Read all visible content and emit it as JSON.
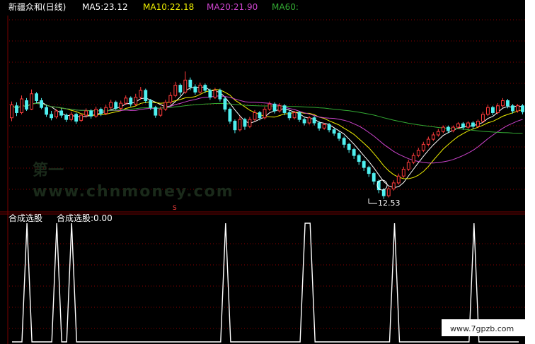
{
  "header": {
    "title": "新疆众和(日线)",
    "ma5": "MA5:23.12",
    "ma10": "MA10:22.18",
    "ma20": "MA20:21.90",
    "ma60": "MA60:"
  },
  "annotation": {
    "low_label": "12.53",
    "marker": "S"
  },
  "watermark": {
    "top": "第一",
    "bottom": "www.chnmoney.com"
  },
  "indicator": {
    "name": "合成选股",
    "value_label": "合成选股:0.00"
  },
  "site_label": "www.7gpzb.com",
  "colors": {
    "background": "#000000",
    "up_candle": "#ff3b3b",
    "down_candle": "#4ff0f0",
    "ma5": "#ffffff",
    "ma10": "#f0f000",
    "ma20": "#cc44cc",
    "ma60": "#33aa33",
    "grid": "#8a0000",
    "signal": "#ffffff"
  },
  "chart_data": [
    {
      "type": "candlestick",
      "title": "新疆众和(日线)",
      "note": "",
      "series": [
        {
          "name": "MA5",
          "last": 23.12
        },
        {
          "name": "MA10",
          "last": 22.18
        },
        {
          "name": "MA20",
          "last": 21.9
        },
        {
          "name": "MA60",
          "last": null
        }
      ],
      "ylim": [
        12,
        30
      ],
      "candles": [
        [
          22.0,
          23.5,
          21.6,
          23.9
        ],
        [
          23.4,
          22.6,
          22.2,
          23.8
        ],
        [
          22.6,
          24.2,
          22.4,
          24.6
        ],
        [
          24.0,
          23.0,
          22.8,
          24.3
        ],
        [
          23.0,
          24.8,
          22.9,
          25.3
        ],
        [
          24.8,
          24.0,
          23.7,
          25.0
        ],
        [
          24.0,
          23.2,
          23.0,
          24.3
        ],
        [
          23.2,
          22.4,
          22.1,
          23.5
        ],
        [
          22.4,
          22.0,
          21.7,
          22.8
        ],
        [
          22.1,
          22.8,
          21.9,
          23.0
        ],
        [
          22.8,
          22.3,
          22.0,
          23.1
        ],
        [
          22.3,
          21.8,
          21.5,
          22.5
        ],
        [
          21.8,
          22.4,
          21.6,
          22.7
        ],
        [
          22.4,
          21.6,
          21.3,
          22.6
        ],
        [
          21.7,
          22.3,
          21.5,
          22.5
        ],
        [
          22.3,
          22.8,
          22.0,
          23.1
        ],
        [
          22.8,
          22.2,
          21.9,
          23.0
        ],
        [
          22.2,
          23.0,
          22.0,
          23.3
        ],
        [
          23.0,
          22.5,
          22.2,
          23.2
        ],
        [
          22.5,
          23.2,
          22.3,
          23.5
        ],
        [
          23.2,
          23.8,
          23.0,
          24.1
        ],
        [
          23.8,
          23.1,
          22.9,
          24.0
        ],
        [
          23.1,
          23.7,
          22.9,
          24.0
        ],
        [
          23.7,
          24.3,
          23.5,
          24.6
        ],
        [
          24.3,
          23.6,
          23.3,
          24.5
        ],
        [
          23.6,
          24.4,
          23.4,
          24.8
        ],
        [
          24.4,
          25.2,
          24.1,
          25.6
        ],
        [
          25.2,
          24.0,
          23.7,
          25.4
        ],
        [
          24.0,
          23.2,
          22.9,
          24.2
        ],
        [
          23.2,
          22.3,
          22.0,
          23.4
        ],
        [
          22.3,
          23.0,
          22.1,
          23.3
        ],
        [
          23.0,
          23.8,
          22.8,
          24.1
        ],
        [
          23.8,
          24.6,
          23.6,
          25.0
        ],
        [
          24.6,
          25.8,
          24.4,
          26.2
        ],
        [
          25.8,
          25.0,
          24.6,
          26.0
        ],
        [
          25.0,
          26.4,
          24.8,
          27.4
        ],
        [
          26.4,
          25.6,
          25.2,
          26.7
        ],
        [
          25.6,
          25.0,
          24.7,
          25.9
        ],
        [
          25.0,
          25.8,
          24.8,
          26.1
        ],
        [
          25.8,
          25.2,
          24.9,
          26.0
        ],
        [
          25.2,
          24.4,
          24.1,
          25.4
        ],
        [
          24.4,
          25.2,
          24.2,
          25.5
        ],
        [
          25.2,
          24.2,
          23.9,
          25.4
        ],
        [
          24.2,
          23.0,
          22.7,
          24.4
        ],
        [
          23.0,
          21.6,
          21.3,
          23.2
        ],
        [
          21.6,
          20.6,
          20.2,
          21.8
        ],
        [
          20.6,
          21.8,
          20.4,
          22.2
        ],
        [
          21.8,
          21.0,
          20.6,
          22.0
        ],
        [
          21.0,
          21.8,
          20.8,
          22.1
        ],
        [
          21.8,
          22.6,
          21.6,
          22.9
        ],
        [
          22.6,
          22.0,
          21.7,
          22.8
        ],
        [
          22.0,
          23.0,
          21.8,
          23.3
        ],
        [
          23.0,
          23.6,
          22.8,
          23.9
        ],
        [
          23.6,
          22.8,
          22.5,
          23.8
        ],
        [
          22.8,
          23.4,
          22.6,
          23.7
        ],
        [
          23.4,
          22.6,
          22.3,
          23.6
        ],
        [
          22.6,
          22.0,
          21.7,
          22.8
        ],
        [
          22.0,
          22.6,
          21.8,
          22.8
        ],
        [
          22.6,
          21.8,
          21.5,
          22.8
        ],
        [
          21.8,
          21.4,
          21.1,
          22.0
        ],
        [
          21.4,
          22.0,
          21.2,
          22.2
        ],
        [
          22.0,
          21.4,
          21.1,
          22.2
        ],
        [
          21.4,
          20.8,
          20.5,
          21.6
        ],
        [
          20.8,
          21.2,
          20.6,
          21.4
        ],
        [
          21.2,
          20.6,
          20.3,
          21.4
        ],
        [
          20.6,
          20.2,
          19.9,
          20.8
        ],
        [
          20.2,
          19.6,
          19.3,
          20.4
        ],
        [
          19.6,
          18.9,
          18.5,
          19.8
        ],
        [
          18.9,
          18.3,
          17.9,
          19.1
        ],
        [
          18.3,
          17.6,
          17.2,
          18.5
        ],
        [
          17.6,
          16.9,
          16.5,
          17.8
        ],
        [
          16.9,
          16.2,
          15.8,
          17.1
        ],
        [
          16.2,
          15.5,
          15.1,
          16.4
        ],
        [
          15.5,
          14.6,
          14.2,
          15.7
        ],
        [
          14.6,
          13.6,
          13.2,
          14.8
        ],
        [
          13.6,
          12.9,
          12.53,
          13.8
        ],
        [
          12.9,
          13.7,
          12.7,
          14.0
        ],
        [
          13.7,
          14.4,
          13.5,
          14.7
        ],
        [
          14.4,
          15.2,
          14.2,
          15.5
        ],
        [
          15.2,
          16.0,
          15.0,
          16.3
        ],
        [
          16.0,
          16.8,
          15.8,
          17.1
        ],
        [
          16.8,
          17.6,
          16.6,
          17.9
        ],
        [
          17.6,
          18.2,
          17.4,
          18.5
        ],
        [
          18.2,
          18.9,
          18.0,
          19.2
        ],
        [
          18.9,
          19.5,
          18.7,
          19.8
        ],
        [
          19.5,
          20.0,
          19.3,
          20.3
        ],
        [
          20.0,
          20.4,
          19.8,
          20.7
        ],
        [
          20.4,
          20.9,
          20.2,
          21.1
        ],
        [
          20.9,
          20.5,
          20.2,
          21.1
        ],
        [
          20.5,
          20.9,
          20.3,
          21.1
        ],
        [
          20.9,
          21.3,
          20.7,
          21.5
        ],
        [
          21.3,
          20.9,
          20.6,
          21.5
        ],
        [
          20.9,
          21.4,
          20.7,
          21.6
        ],
        [
          21.4,
          21.0,
          20.7,
          21.6
        ],
        [
          21.0,
          21.6,
          20.8,
          21.8
        ],
        [
          21.6,
          22.4,
          21.4,
          22.7
        ],
        [
          22.4,
          23.2,
          22.2,
          23.5
        ],
        [
          23.2,
          22.6,
          22.3,
          23.4
        ],
        [
          22.6,
          23.4,
          22.4,
          23.7
        ],
        [
          23.4,
          24.0,
          23.2,
          24.3
        ],
        [
          24.0,
          23.4,
          23.1,
          24.2
        ],
        [
          23.4,
          22.8,
          22.5,
          23.6
        ],
        [
          22.8,
          23.4,
          22.6,
          23.6
        ],
        [
          23.4,
          22.7,
          22.4,
          23.6
        ]
      ]
    },
    {
      "type": "line",
      "title": "合成选股",
      "series": [
        {
          "name": "合成选股",
          "last": 0.0
        }
      ],
      "ylim": [
        0,
        1
      ],
      "signal_index_hint": [
        1,
        9,
        12,
        44,
        59,
        76,
        93
      ],
      "levels": [
        0,
        0,
        0,
        1,
        0,
        0,
        0,
        0,
        0,
        1,
        0,
        0,
        1,
        0,
        0,
        0,
        0,
        0,
        0,
        0,
        0,
        0,
        0,
        0,
        0,
        0,
        0,
        0,
        0,
        0,
        0,
        0,
        0,
        0,
        0,
        0,
        0,
        0,
        0,
        0,
        0,
        0,
        0,
        1,
        0,
        0,
        0,
        0,
        0,
        0,
        0,
        0,
        0,
        0,
        0,
        0,
        0,
        0,
        0,
        1,
        1,
        0,
        0,
        0,
        0,
        0,
        0,
        0,
        0,
        0,
        0,
        0,
        0,
        0,
        0,
        0,
        0,
        1,
        0,
        0,
        0,
        0,
        0,
        0,
        0,
        0,
        0,
        0,
        0,
        0,
        0,
        0,
        0,
        1,
        0,
        0,
        0,
        0,
        0,
        0,
        0,
        0,
        0
      ]
    }
  ]
}
